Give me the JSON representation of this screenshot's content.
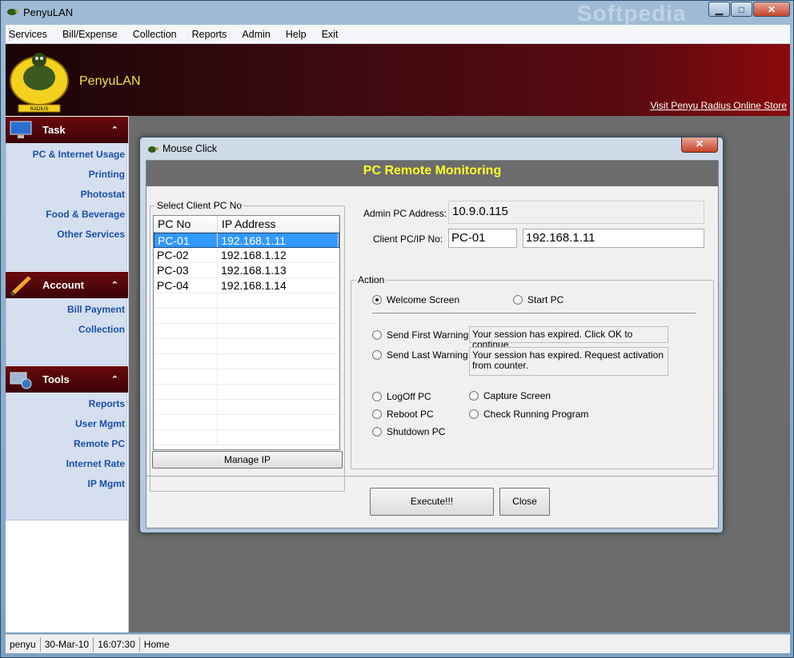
{
  "window": {
    "title": "PenyuLAN",
    "watermark": "Softpedia",
    "minimize": "▁",
    "maximize": "□",
    "close": "✕"
  },
  "menu": [
    "Services",
    "Bill/Expense",
    "Collection",
    "Reports",
    "Admin",
    "Help",
    "Exit"
  ],
  "banner": {
    "brand": "PenyuLAN",
    "store_link": "Visit Penyu Radius Online Store",
    "logo_text": "RADIUS"
  },
  "sidebar": {
    "task": {
      "title": "Task",
      "items": [
        "PC & Internet Usage",
        "Printing",
        "Photostat",
        "Food & Beverage",
        "Other Services"
      ]
    },
    "account": {
      "title": "Account",
      "items": [
        "Bill Payment",
        "Collection"
      ]
    },
    "tools": {
      "title": "Tools",
      "items": [
        "Reports",
        "User Mgmt",
        "Remote PC",
        "Internet Rate",
        "IP Mgmt"
      ]
    },
    "chevron": "⌃"
  },
  "status": {
    "user": "penyu",
    "date": "30-Mar-10",
    "time": "16:07:30",
    "page": "Home"
  },
  "dialog": {
    "title": "Mouse Click",
    "close": "✕",
    "header": "PC Remote Monitoring",
    "client_group": "Select Client PC No",
    "columns": [
      "PC No",
      "IP Address"
    ],
    "rows": [
      {
        "pc": "PC-01",
        "ip": "192.168.1.11"
      },
      {
        "pc": "PC-02",
        "ip": "192.168.1.12"
      },
      {
        "pc": "PC-03",
        "ip": "192.168.1.13"
      },
      {
        "pc": "PC-04",
        "ip": "192.168.1.14"
      }
    ],
    "manage_ip": "Manage IP",
    "admin_label": "Admin PC Address:",
    "admin_value": "10.9.0.115",
    "client_label": "Client PC/IP No:",
    "client_pc": "PC-01",
    "client_ip": "192.168.1.11",
    "action_group": "Action",
    "welcome": "Welcome Screen",
    "start_pc": "Start PC",
    "first_warning": "Send First Warning",
    "first_warning_msg": "Your session has expired. Click OK to continue.",
    "last_warning": "Send Last Warning",
    "last_warning_msg": "Your session has expired. Request activation from counter.",
    "logoff": "LogOff PC",
    "capture": "Capture Screen",
    "reboot": "Reboot PC",
    "check_running": "Check Running Program",
    "shutdown": "Shutdown PC",
    "execute": "Execute!!!",
    "close_btn": "Close"
  }
}
